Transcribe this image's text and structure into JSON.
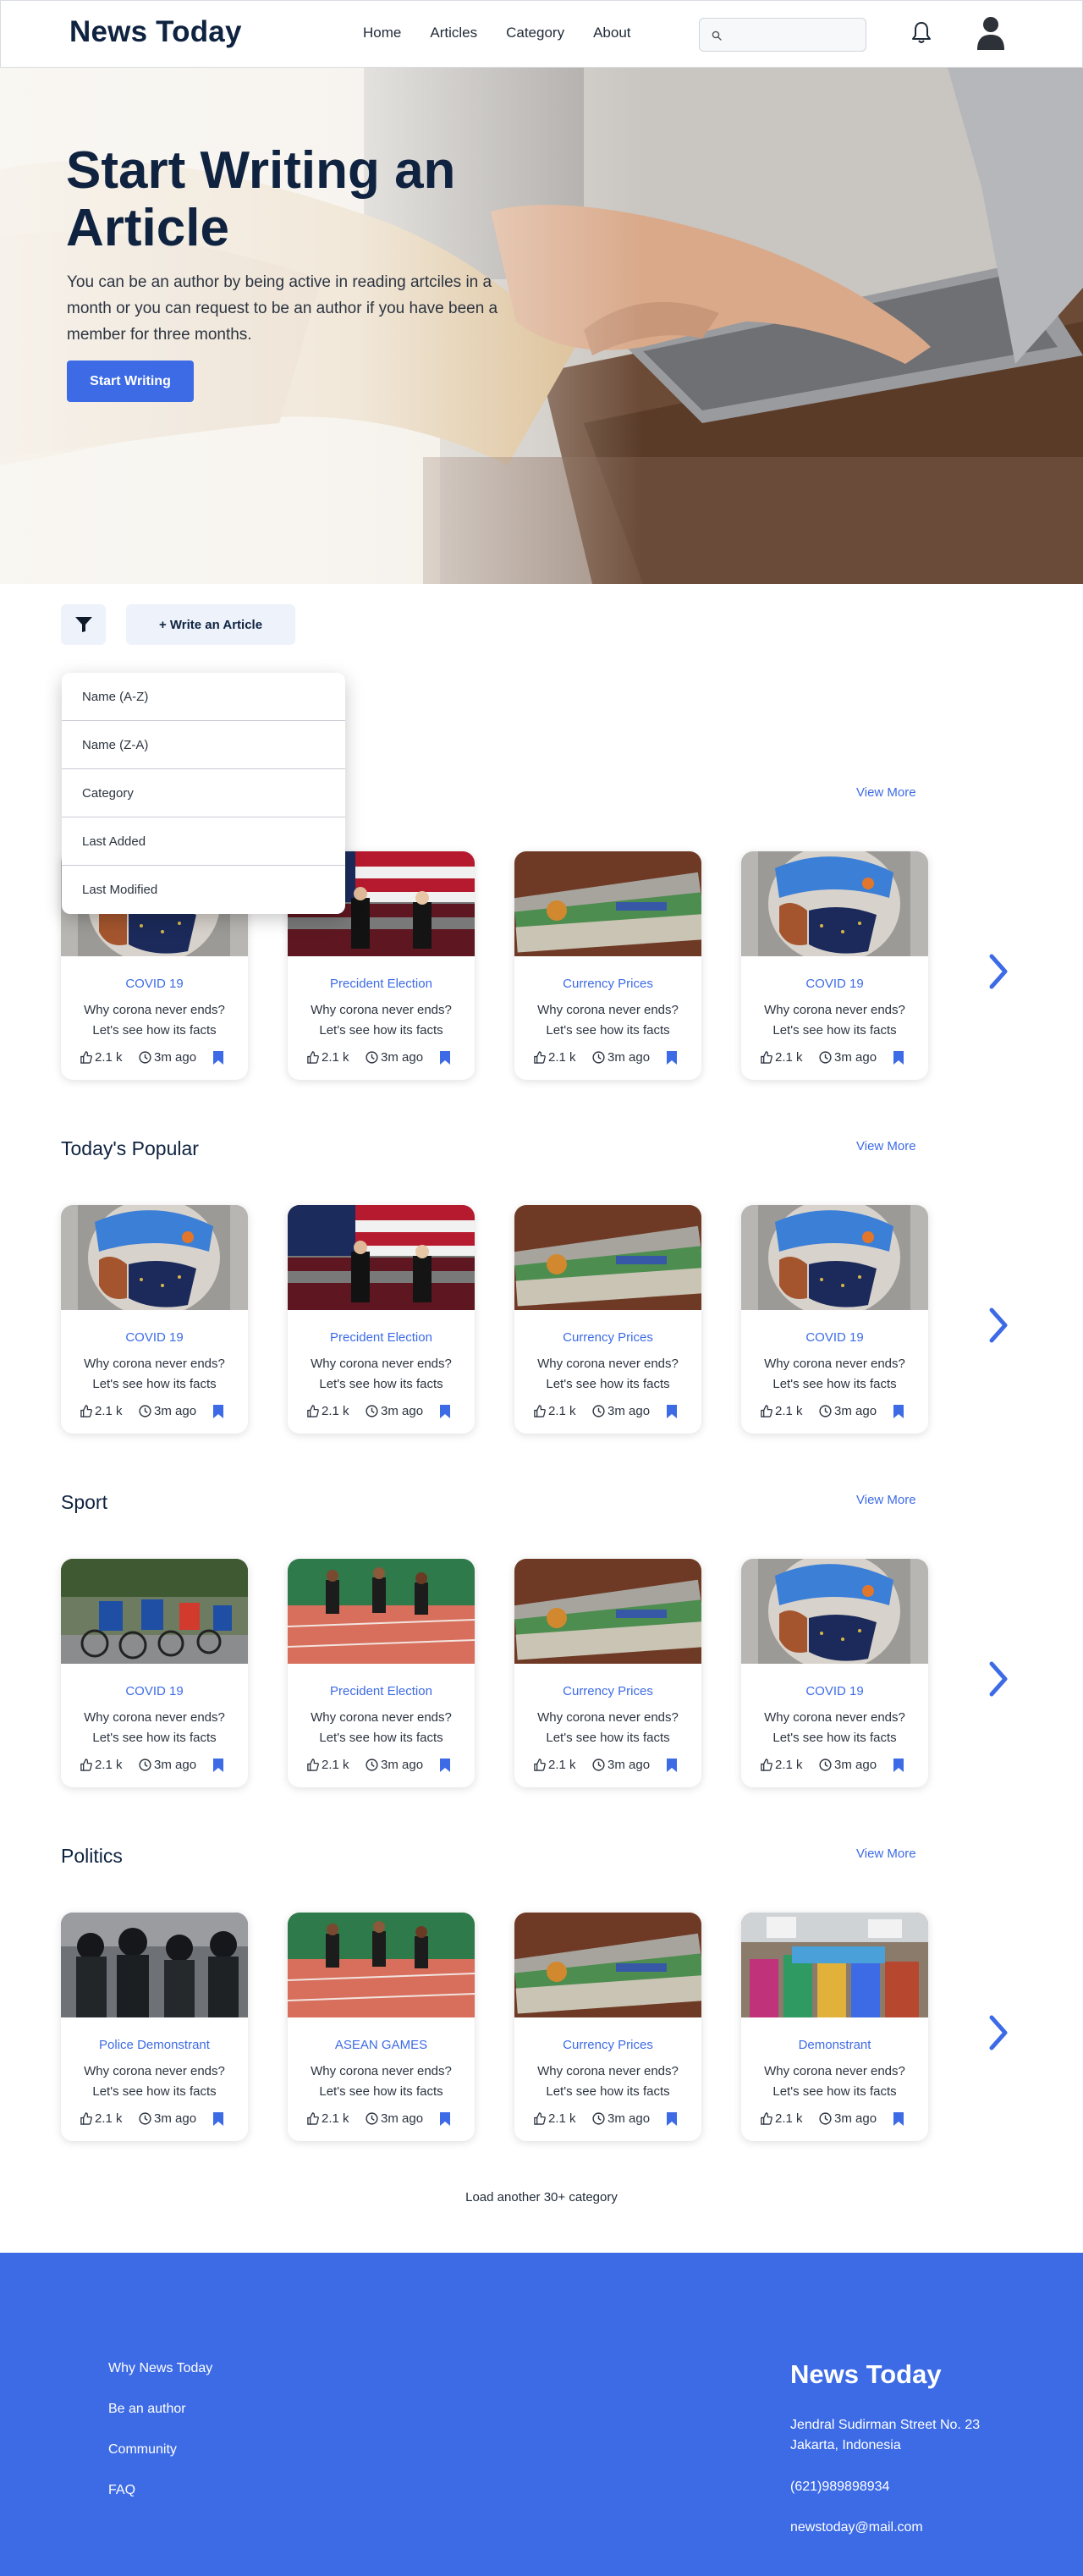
{
  "nav": {
    "brand": "News Today",
    "links": [
      "Home",
      "Articles",
      "Category",
      "About"
    ],
    "search_placeholder": ""
  },
  "hero": {
    "title": "Start Writing an Article",
    "subtitle": "You can be an author by being active in reading artciles in a month or you can request to be an author if you have been a member for three months.",
    "button": "Start Writing"
  },
  "toolbar": {
    "write_button": "+ Write an Article",
    "sort_options": [
      "Name (A-Z)",
      "Name (Z-A)",
      "Category",
      "Last Added",
      "Last Modified"
    ]
  },
  "view_more": "View More",
  "sections": [
    {
      "title": "",
      "cards": [
        {
          "image": "corona-mask",
          "category": "COVID 19",
          "text": "Why corona never ends? Let's see how its facts",
          "likes": "2.1 k",
          "time": "3m ago"
        },
        {
          "image": "election",
          "category": "Precident Election",
          "text": "Why corona never ends? Let's see how its facts",
          "likes": "2.1 k",
          "time": "3m ago"
        },
        {
          "image": "currency",
          "category": "Currency Prices",
          "text": "Why corona never ends? Let's see how its facts",
          "likes": "2.1 k",
          "time": "3m ago"
        },
        {
          "image": "corona-mask",
          "category": "COVID 19",
          "text": "Why corona never ends? Let's see how its facts",
          "likes": "2.1 k",
          "time": "3m ago"
        }
      ]
    },
    {
      "title": "Today's Popular",
      "cards": [
        {
          "image": "corona-mask",
          "category": "COVID 19",
          "text": "Why corona never ends? Let's see how its facts",
          "likes": "2.1 k",
          "time": "3m ago"
        },
        {
          "image": "election",
          "category": "Precident Election",
          "text": "Why corona never ends? Let's see how its facts",
          "likes": "2.1 k",
          "time": "3m ago"
        },
        {
          "image": "currency",
          "category": "Currency Prices",
          "text": "Why corona never ends? Let's see how its facts",
          "likes": "2.1 k",
          "time": "3m ago"
        },
        {
          "image": "corona-mask",
          "category": "COVID 19",
          "text": "Why corona never ends? Let's see how its facts",
          "likes": "2.1 k",
          "time": "3m ago"
        }
      ]
    },
    {
      "title": "Sport",
      "cards": [
        {
          "image": "cycling",
          "category": "COVID 19",
          "text": "Why corona never ends? Let's see how its facts",
          "likes": "2.1 k",
          "time": "3m ago"
        },
        {
          "image": "running",
          "category": "Precident Election",
          "text": "Why corona never ends? Let's see how its facts",
          "likes": "2.1 k",
          "time": "3m ago"
        },
        {
          "image": "currency",
          "category": "Currency Prices",
          "text": "Why corona never ends? Let's see how its facts",
          "likes": "2.1 k",
          "time": "3m ago"
        },
        {
          "image": "corona-mask",
          "category": "COVID 19",
          "text": "Why corona never ends? Let's see how its facts",
          "likes": "2.1 k",
          "time": "3m ago"
        }
      ]
    },
    {
      "title": "Politics",
      "cards": [
        {
          "image": "police",
          "category": "Police Demonstrant",
          "text": "Why corona never ends? Let's see how its facts",
          "likes": "2.1 k",
          "time": "3m ago"
        },
        {
          "image": "running",
          "category": "ASEAN GAMES",
          "text": "Why corona never ends? Let's see how its facts",
          "likes": "2.1 k",
          "time": "3m ago"
        },
        {
          "image": "currency",
          "category": "Currency Prices",
          "text": "Why corona never ends? Let's see how its facts",
          "likes": "2.1 k",
          "time": "3m ago"
        },
        {
          "image": "demonstration",
          "category": "Demonstrant",
          "text": "Why corona never ends? Let's see how its facts",
          "likes": "2.1 k",
          "time": "3m ago"
        }
      ]
    }
  ],
  "load_more": "Load another 30+ category",
  "footer": {
    "links": [
      "Why News Today",
      "Be an author",
      "Community",
      "FAQ"
    ],
    "brand": "News Today",
    "address_line1": "Jendral Sudirman Street No. 23",
    "address_line2": "Jakarta, Indonesia",
    "phone": "(621)989898934",
    "email": "newstoday@mail.com"
  },
  "colors": {
    "accent": "#3d6be6",
    "navy": "#0f2340",
    "light_button": "#eef2fb"
  }
}
